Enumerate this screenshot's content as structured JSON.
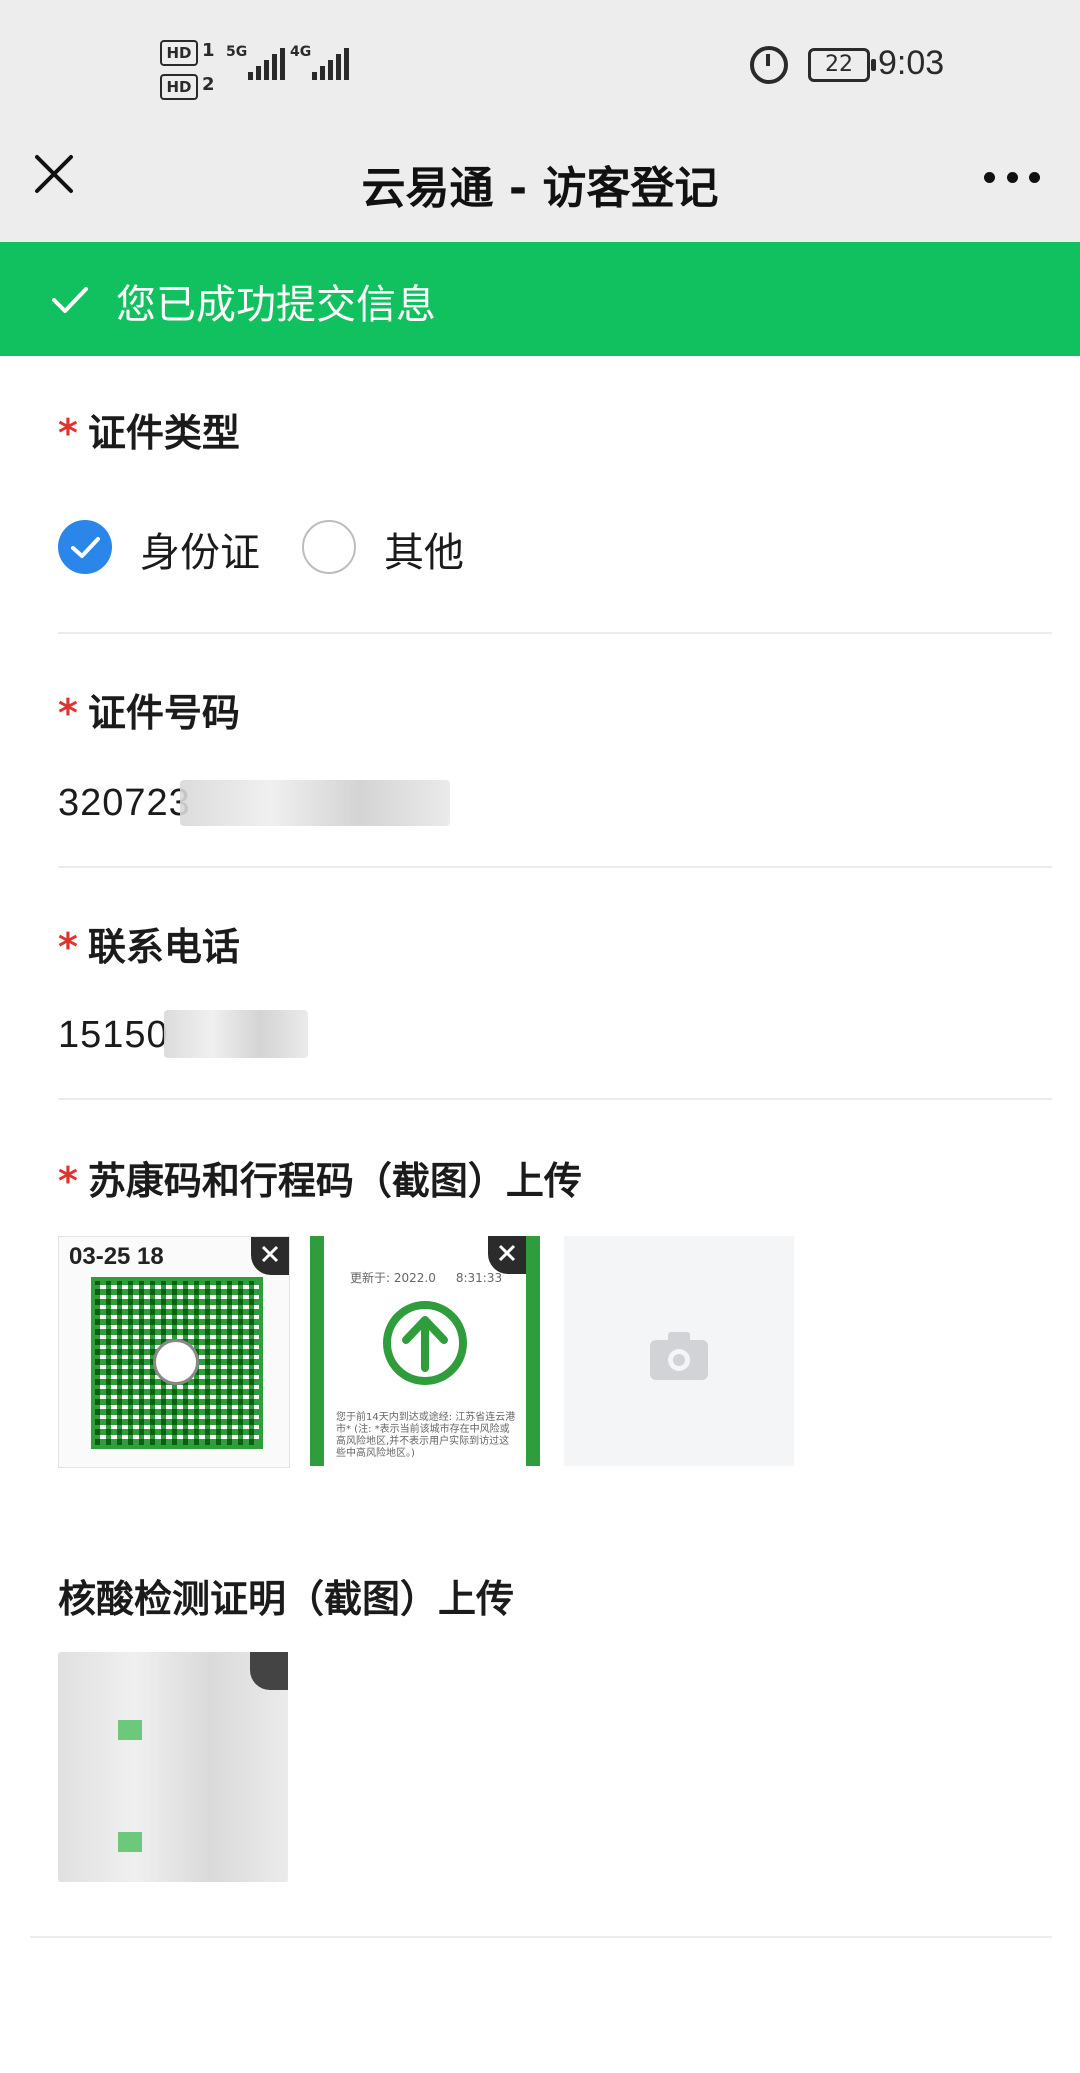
{
  "status_bar": {
    "sim1": "HD",
    "sim1_num": "1",
    "sim2": "HD",
    "sim2_num": "2",
    "net1": "5G",
    "net2": "4G",
    "battery": "22",
    "time": "9:03"
  },
  "header": {
    "title": "云易通 - 访客登记"
  },
  "banner": {
    "message": "您已成功提交信息",
    "color": "#11c15f"
  },
  "form": {
    "id_type": {
      "required": "*",
      "label": "证件类型",
      "options": [
        {
          "label": "身份证",
          "selected": true
        },
        {
          "label": "其他",
          "selected": false
        }
      ]
    },
    "id_number": {
      "required": "*",
      "label": "证件号码",
      "value": "320723"
    },
    "phone": {
      "required": "*",
      "label": "联系电话",
      "value": "15150"
    },
    "health_code": {
      "required": "*",
      "label": "苏康码和行程码（截图）上传",
      "image1_stamp": "03-25 18",
      "image2_updated": "更新于: 2022.0",
      "image2_time": "8:31:33",
      "image2_note": "您于前14天内到达或途经: 江苏省连云港市* (注: *表示当前该城市存在中风险或高风险地区,并不表示用户实际到访过这些中高风险地区。)"
    },
    "nucleic_test": {
      "label": "核酸检测证明（截图）上传"
    }
  },
  "colors": {
    "accent_blue": "#2a86e8",
    "required_red": "#e0332d",
    "code_green": "#2f9d3b"
  }
}
